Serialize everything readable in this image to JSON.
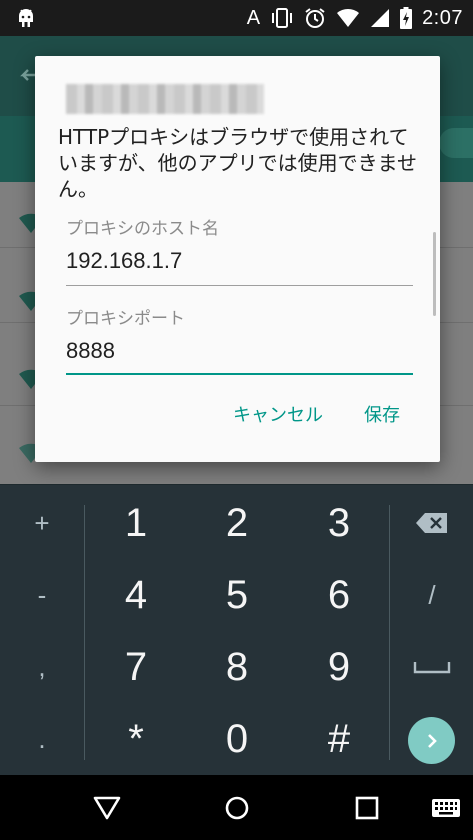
{
  "status_bar": {
    "ime_indicator": "A",
    "time": "2:07",
    "icons": [
      "android-icon",
      "vibrate-icon",
      "alarm-icon",
      "wifi-icon",
      "signal-icon",
      "battery-charging-icon"
    ]
  },
  "dialog": {
    "message": "HTTPプロキシはブラウザで使用されていますが、他のアプリでは使用できません。",
    "host_field": {
      "label": "プロキシのホスト名",
      "value": "192.168.1.7"
    },
    "port_field": {
      "label": "プロキシポート",
      "value": "8888"
    },
    "cancel_label": "キャンセル",
    "save_label": "保存"
  },
  "keyboard": {
    "left_keys": [
      "+",
      "-",
      ",",
      "."
    ],
    "digits": [
      [
        "1",
        "2",
        "3"
      ],
      [
        "4",
        "5",
        "6"
      ],
      [
        "7",
        "8",
        "9"
      ],
      [
        "*",
        "0",
        "#"
      ]
    ],
    "right_keys": [
      "backspace-icon",
      "/",
      "space-icon",
      "go-icon"
    ],
    "slash_label": "/"
  },
  "nav_bar": {
    "icons": [
      "back-icon",
      "home-icon",
      "recents-icon",
      "keyboard-switch-icon"
    ]
  },
  "colors": {
    "accent": "#009688",
    "dialog_bg": "#fafafa",
    "keyboard_bg": "#263238",
    "go_key": "#80cbc4"
  }
}
